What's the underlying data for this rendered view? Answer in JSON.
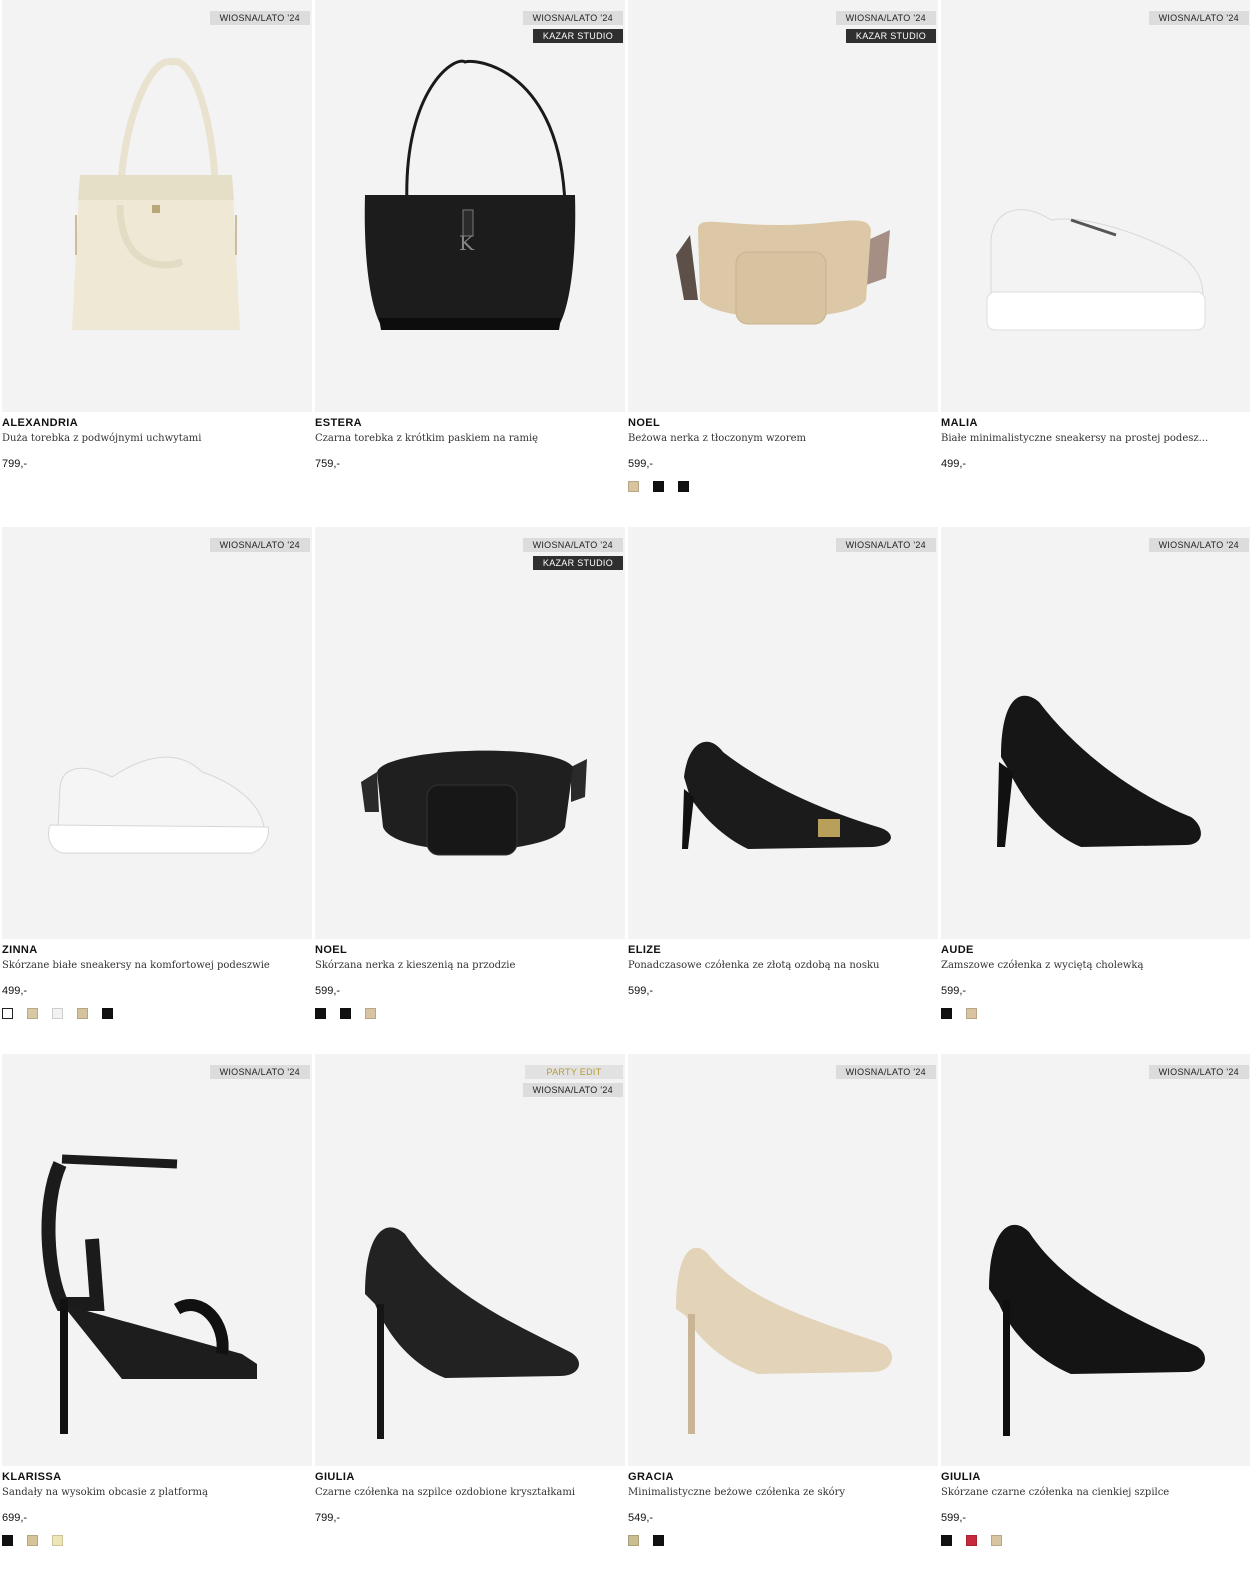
{
  "products": [
    {
      "name": "ALEXANDRIA",
      "description": "Duża torebka z podwójnymi uchwytami",
      "price": "799,-",
      "tags": [
        {
          "label": "WIOSNA/LATO '24",
          "style": "season"
        }
      ],
      "image": "cream-tote-bag",
      "swatches": []
    },
    {
      "name": "ESTERA",
      "description": "Czarna torebka z krótkim paskiem na ramię",
      "price": "759,-",
      "tags": [
        {
          "label": "WIOSNA/LATO '24",
          "style": "season"
        },
        {
          "label": "KAZAR STUDIO",
          "style": "studio"
        }
      ],
      "image": "black-shoulder-bag",
      "swatches": []
    },
    {
      "name": "NOEL",
      "description": "Beżowa nerka z tłoczonym wzorem",
      "price": "599,-",
      "tags": [
        {
          "label": "WIOSNA/LATO '24",
          "style": "season"
        },
        {
          "label": "KAZAR STUDIO",
          "style": "studio"
        }
      ],
      "image": "beige-belt-bag",
      "swatches": [
        "#d8c4a0",
        "#111111",
        "#111111"
      ]
    },
    {
      "name": "MALIA",
      "description": "Białe minimalistyczne sneakersy na prostej podesz...",
      "price": "499,-",
      "tags": [
        {
          "label": "WIOSNA/LATO '24",
          "style": "season"
        }
      ],
      "image": "white-platform-sneaker",
      "swatches": []
    },
    {
      "name": "ZINNA",
      "description": "Skórzane białe sneakersy na komfortowej podeszwie",
      "price": "499,-",
      "tags": [
        {
          "label": "WIOSNA/LATO '24",
          "style": "season"
        }
      ],
      "image": "white-runner-sneaker",
      "swatches": [
        "#ffffff",
        "#d8c9a4",
        "#f2f2f2",
        "#d4c39b",
        "#111111"
      ]
    },
    {
      "name": "NOEL",
      "description": "Skórzana nerka z kieszenią na przodzie",
      "price": "599,-",
      "tags": [
        {
          "label": "WIOSNA/LATO '24",
          "style": "season"
        },
        {
          "label": "KAZAR STUDIO",
          "style": "studio"
        }
      ],
      "image": "black-belt-bag",
      "swatches": [
        "#111111",
        "#111111",
        "#d8c4a0"
      ]
    },
    {
      "name": "ELIZE",
      "description": "Ponadczasowe czółenka ze złotą ozdobą na nosku",
      "price": "599,-",
      "tags": [
        {
          "label": "WIOSNA/LATO '24",
          "style": "season"
        }
      ],
      "image": "black-pump-gold-ornament",
      "swatches": []
    },
    {
      "name": "AUDE",
      "description": "Zamszowe czółenka z wyciętą cholewką",
      "price": "599,-",
      "tags": [
        {
          "label": "WIOSNA/LATO '24",
          "style": "season"
        }
      ],
      "image": "black-suede-peep-toe",
      "swatches": [
        "#111111",
        "#d8c4a0"
      ]
    },
    {
      "name": "KLARISSA",
      "description": "Sandały na wysokim obcasie z platformą",
      "price": "699,-",
      "tags": [
        {
          "label": "WIOSNA/LATO '24",
          "style": "season"
        }
      ],
      "image": "black-platform-sandal",
      "swatches": [
        "#111111",
        "#d6c397",
        "#efe6b8"
      ]
    },
    {
      "name": "GIULIA",
      "description": "Czarne czółenka na szpilce ozdobione kryształkami",
      "price": "799,-",
      "tags": [
        {
          "label": "PARTY EDIT",
          "style": "party"
        },
        {
          "label": "WIOSNA/LATO '24",
          "style": "season"
        }
      ],
      "image": "black-crystal-stiletto",
      "swatches": []
    },
    {
      "name": "GRACIA",
      "description": "Minimalistyczne beżowe czółenka ze skóry",
      "price": "549,-",
      "tags": [
        {
          "label": "WIOSNA/LATO '24",
          "style": "season"
        }
      ],
      "image": "beige-pump",
      "swatches": [
        "#c9bd92",
        "#111111"
      ]
    },
    {
      "name": "GIULIA",
      "description": "Skórzane czarne czółenka na cienkiej szpilce",
      "price": "599,-",
      "tags": [
        {
          "label": "WIOSNA/LATO '24",
          "style": "season"
        }
      ],
      "image": "black-leather-stiletto",
      "swatches": [
        "#111111",
        "#c8283c",
        "#d8c4a0"
      ]
    }
  ]
}
